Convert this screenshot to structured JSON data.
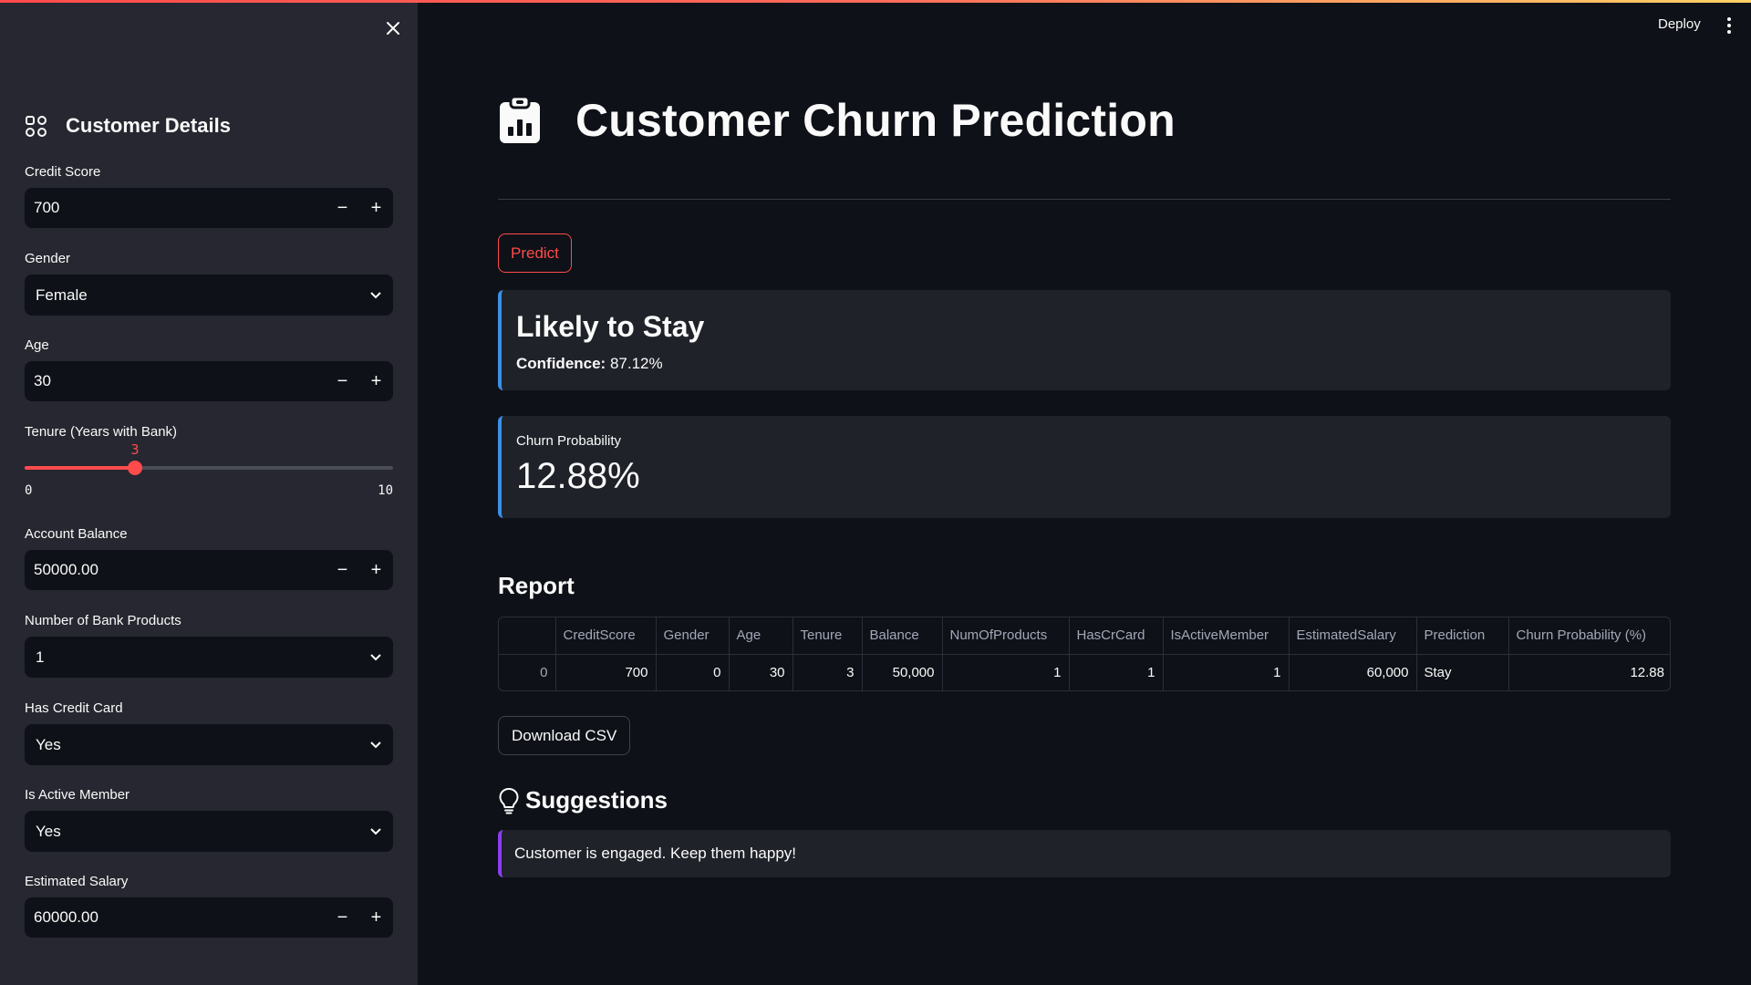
{
  "header": {
    "deploy_label": "Deploy"
  },
  "sidebar": {
    "title": "Customer Details",
    "credit_score": {
      "label": "Credit Score",
      "value": "700"
    },
    "gender": {
      "label": "Gender",
      "value": "Female"
    },
    "age": {
      "label": "Age",
      "value": "30"
    },
    "tenure": {
      "label": "Tenure (Years with Bank)",
      "value": 3,
      "value_text": "3",
      "min": 0,
      "max": 10,
      "min_text": "0",
      "max_text": "10"
    },
    "balance": {
      "label": "Account Balance",
      "value": "50000.00"
    },
    "products": {
      "label": "Number of Bank Products",
      "value": "1"
    },
    "credit_card": {
      "label": "Has Credit Card",
      "value": "Yes"
    },
    "active": {
      "label": "Is Active Member",
      "value": "Yes"
    },
    "salary": {
      "label": "Estimated Salary",
      "value": "60000.00"
    },
    "icons": {
      "close": "close-icon",
      "header": "grid-icon",
      "minus": "minus-icon",
      "plus": "plus-icon",
      "chevron": "chevron-down-icon"
    }
  },
  "main": {
    "title": "Customer Churn Prediction",
    "title_icon": "clipboard-chart-icon",
    "predict_label": "Predict",
    "result": {
      "title": "Likely to Stay",
      "confidence_label": "Confidence:",
      "confidence_value": "87.12%"
    },
    "probability": {
      "label": "Churn Probability",
      "value": "12.88%"
    },
    "report": {
      "title": "Report",
      "columns": [
        "",
        "CreditScore",
        "Gender",
        "Age",
        "Tenure",
        "Balance",
        "NumOfProducts",
        "HasCrCard",
        "IsActiveMember",
        "EstimatedSalary",
        "Prediction",
        "Churn Probability (%)"
      ],
      "rows": [
        [
          "0",
          "700",
          "0",
          "30",
          "3",
          "50,000",
          "1",
          "1",
          "1",
          "60,000",
          "Stay",
          "12.88"
        ]
      ]
    },
    "download_label": "Download CSV",
    "suggestions": {
      "title": "Suggestions",
      "icon": "lightbulb-icon",
      "text": "Customer is engaged. Keep them happy!"
    }
  },
  "colors": {
    "accent": "#ff4b4b",
    "info": "#3b8fe6",
    "suggestion": "#8b3ff0"
  }
}
